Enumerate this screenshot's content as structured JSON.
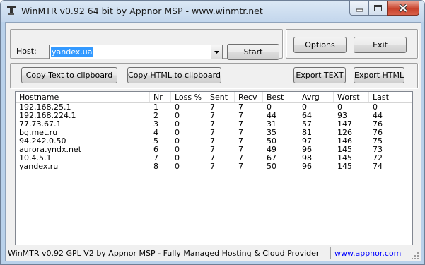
{
  "window": {
    "title": "WinMTR v0.92 64 bit by Appnor MSP - www.winmtr.net"
  },
  "host": {
    "label": "Host:",
    "value": "yandex.ua"
  },
  "buttons": {
    "start": "Start",
    "options": "Options",
    "exit": "Exit",
    "copy_text": "Copy Text to clipboard",
    "copy_html": "Copy HTML to clipboard",
    "export_text": "Export TEXT",
    "export_html": "Export HTML"
  },
  "table": {
    "columns": [
      "Hostname",
      "Nr",
      "Loss %",
      "Sent",
      "Recv",
      "Best",
      "Avrg",
      "Worst",
      "Last"
    ],
    "rows": [
      [
        "192.168.25.1",
        "1",
        "0",
        "7",
        "7",
        "0",
        "0",
        "0",
        "0"
      ],
      [
        "192.168.224.1",
        "2",
        "0",
        "7",
        "7",
        "44",
        "64",
        "93",
        "44"
      ],
      [
        "77.73.67.1",
        "3",
        "0",
        "7",
        "7",
        "31",
        "57",
        "147",
        "76"
      ],
      [
        "bg.met.ru",
        "4",
        "0",
        "7",
        "7",
        "35",
        "81",
        "126",
        "76"
      ],
      [
        "94.242.0.50",
        "5",
        "0",
        "7",
        "7",
        "50",
        "97",
        "146",
        "75"
      ],
      [
        "aurora.yndx.net",
        "6",
        "0",
        "7",
        "7",
        "49",
        "96",
        "145",
        "73"
      ],
      [
        "10.4.5.1",
        "7",
        "0",
        "7",
        "7",
        "67",
        "98",
        "145",
        "72"
      ],
      [
        "yandex.ru",
        "8",
        "0",
        "7",
        "7",
        "50",
        "96",
        "145",
        "74"
      ]
    ]
  },
  "status": {
    "text": "WinMTR v0.92 GPL V2 by Appnor MSP - Fully Managed Hosting & Cloud Provider",
    "link": "www.appnor.com"
  },
  "icons": {
    "app": "winmtr-app-icon",
    "minimize": "minimize-icon",
    "maximize": "maximize-icon",
    "close": "close-icon",
    "dropdown": "chevron-down-icon",
    "grip": "resize-grip-icon"
  },
  "colors": {
    "selection": "#3399ff",
    "link": "#0000ff",
    "close_button": "#c8422c"
  }
}
